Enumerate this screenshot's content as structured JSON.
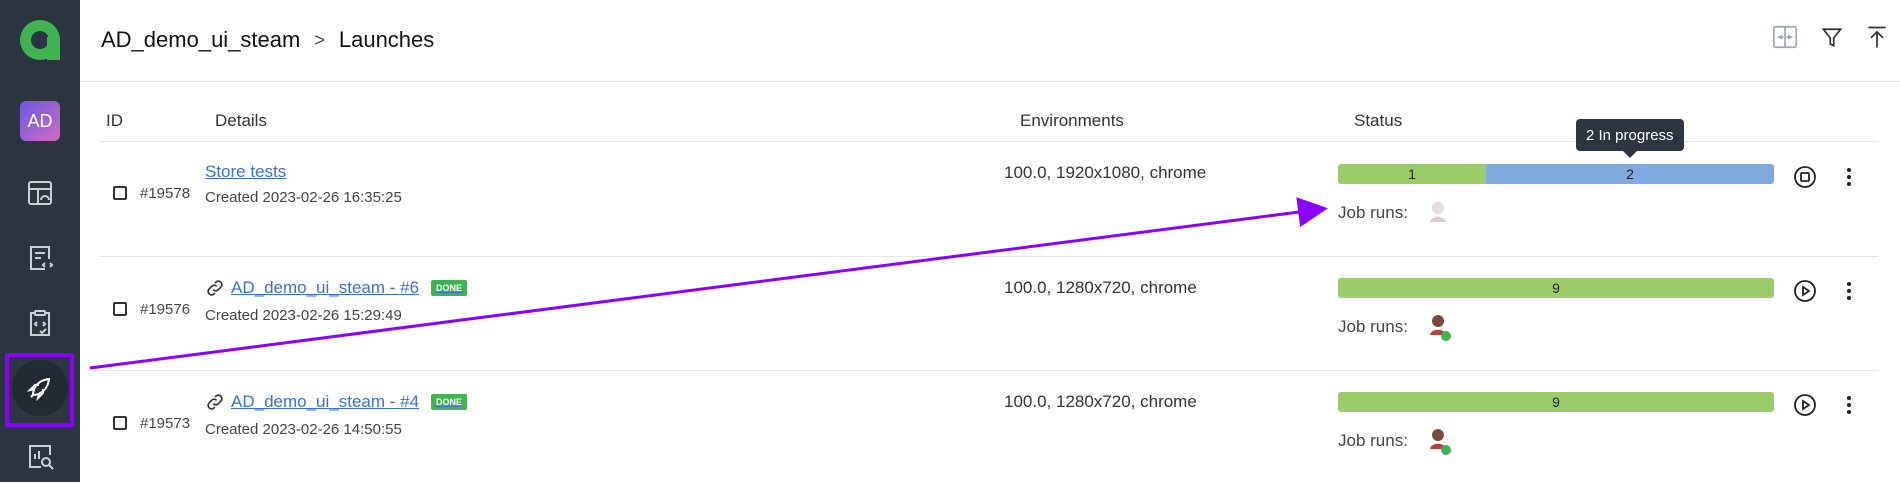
{
  "header": {
    "project": "AD_demo_ui_steam",
    "separator": ">",
    "page": "Launches"
  },
  "sidebar": {
    "avatar_initials": "AD",
    "items": [
      "dashboard-icon",
      "test-cases-icon",
      "test-plans-icon",
      "launches-icon",
      "reports-icon"
    ]
  },
  "columns": {
    "id": "ID",
    "details": "Details",
    "environments": "Environments",
    "status": "Status"
  },
  "tooltip": "2 In progress",
  "rows": [
    {
      "id": "#19578",
      "title": "Store tests",
      "created": "Created 2023-02-26 16:35:25",
      "env": "100.0, 1920x1080, chrome",
      "status_badge": "",
      "bar": [
        {
          "label": "1",
          "value": 1,
          "color": "#9bcc6a"
        },
        {
          "label": "2",
          "value": 2,
          "color": "#7faadd"
        }
      ],
      "job_runs": "Job runs:",
      "action": "stop-icon"
    },
    {
      "id": "#19576",
      "title": "AD_demo_ui_steam - #6",
      "created": "Created 2023-02-26 15:29:49",
      "env": "100.0, 1280x720, chrome",
      "status_badge": "DONE",
      "bar": [
        {
          "label": "9",
          "value": 9,
          "color": "#9bcc6a"
        }
      ],
      "job_runs": "Job runs:",
      "action": "play-icon"
    },
    {
      "id": "#19573",
      "title": "AD_demo_ui_steam - #4",
      "created": "Created 2023-02-26 14:50:55",
      "env": "100.0, 1280x720, chrome",
      "status_badge": "DONE",
      "bar": [
        {
          "label": "9",
          "value": 9,
          "color": "#9bcc6a"
        }
      ],
      "job_runs": "Job runs:",
      "action": "play-icon"
    }
  ],
  "colors": {
    "sidebar": "#2d3640",
    "passed": "#9bcc6a",
    "in_progress": "#7faadd",
    "annotation": "#8b00ff",
    "link": "#3a6fd8"
  }
}
